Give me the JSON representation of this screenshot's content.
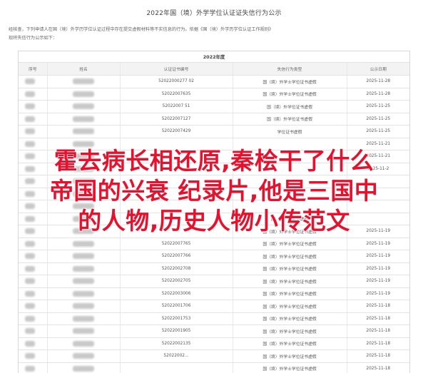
{
  "page": {
    "title": "2022年国（境）外学学位认证证失信行为公示",
    "notice_line1": "经核查，下列申请人在国（境）外学历学位认证过程中存在提交虚假材料等不实信息的行为。依据《国（境）外学历学位认证工作规则》",
    "notice_line2": "现将失信行为公示如下："
  },
  "table": {
    "caption": "2022年度",
    "columns": [
      "序号",
      "姓名",
      "认证证书编号",
      "失信行为类型",
      "公示日期"
    ],
    "rows": [
      {
        "cert": "52022000277 02",
        "type": "国（境）外学士学位证书虚假",
        "date": "2025-11-28"
      },
      {
        "cert": "52022007635",
        "type": "国（境）外学士学位证书虚假",
        "date": "2025-11-28"
      },
      {
        "cert": "52022007 51",
        "type": "国（境）外学位证书虚假",
        "date": "2025-11-25"
      },
      {
        "cert": "52022007127",
        "type": "国（境）外学位证书虚假",
        "date": "2025-11-25"
      },
      {
        "cert": "52022007429",
        "type": "学位证书虚假",
        "date": "2025-11-25"
      },
      {
        "cert": "",
        "type": "",
        "date": "2025-11-21"
      },
      {
        "cert": "",
        "type": "",
        "date": "2025-11-21"
      },
      {
        "cert": "",
        "type": "",
        "date": "2025-11-2"
      },
      {
        "cert": "",
        "type": "",
        "date": ""
      },
      {
        "cert": "",
        "type": "",
        "date": ""
      },
      {
        "cert": "",
        "type": "",
        "date": ""
      },
      {
        "cert": "",
        "type": "国（境）外学书虚假",
        "date": ""
      },
      {
        "cert": "",
        "type": "国（境）外学士学位证书虚假",
        "date": "2025-11-19"
      },
      {
        "cert": "52022007765",
        "type": "国（境）外学士学位证书虚假",
        "date": "2025-11-19"
      },
      {
        "cert": "52022007766",
        "type": "国（境）外学士学位证书虚假",
        "date": "2025-11-19"
      },
      {
        "cert": "52022002708",
        "type": "国（境）外学士学位证书虚假",
        "date": "2025-11-19"
      },
      {
        "cert": "52022002705",
        "type": "国（境）外学士学位证书虚假",
        "date": "2025-11-19"
      },
      {
        "cert": "52022003006",
        "type": "国（境）外学士学位证书虚假",
        "date": "2025-11-19"
      },
      {
        "cert": "52022001706",
        "type": "国（境）外学士学位证书虚假",
        "date": "2025-11-18"
      },
      {
        "cert": "52022001753",
        "type": "国（境）外学士学位证书虚假",
        "date": "2025-11-18"
      },
      {
        "cert": "52022001905",
        "type": "国（境）外学士学位证书虚假",
        "date": "2025-11-18"
      },
      {
        "cert": "52022002135",
        "type": "国（境）外学士学位证书虚假",
        "date": "2025-11-18"
      },
      {
        "cert": "52022002...",
        "type": "国（境）外学士学位证书虚假",
        "date": "2025-11-18"
      },
      {
        "cert": "",
        "type": "国（境）外学士学位证书虚假",
        "date": "2025-11-18"
      }
    ]
  },
  "overlay": {
    "line1": "霍去病长相还原,秦桧干了什么",
    "line2": "帝国的兴衰 纪录片,他是三国中",
    "line3": "的人物,历史人物小传范文"
  }
}
